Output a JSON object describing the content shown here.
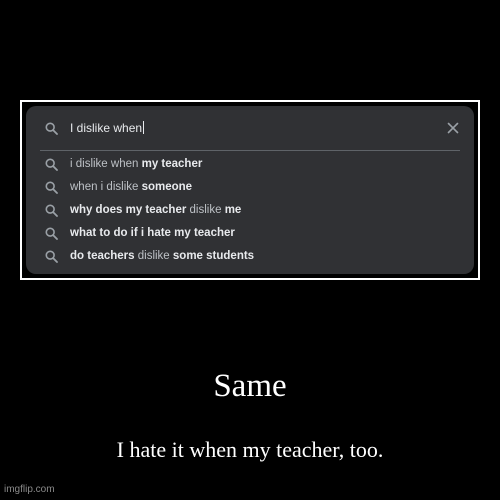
{
  "search": {
    "query": "I dislike when",
    "icon": "search-icon",
    "clear_icon": "close-icon"
  },
  "suggestions": [
    {
      "parts": [
        {
          "text": "i dislike when ",
          "bold": false
        },
        {
          "text": "my teacher",
          "bold": true
        }
      ]
    },
    {
      "parts": [
        {
          "text": "when i dislike ",
          "bold": false
        },
        {
          "text": "someone",
          "bold": true
        }
      ]
    },
    {
      "parts": [
        {
          "text": "why does my teacher ",
          "bold": true
        },
        {
          "text": "dislike ",
          "bold": false
        },
        {
          "text": "me",
          "bold": true
        }
      ]
    },
    {
      "parts": [
        {
          "text": "what to do if i hate my teacher",
          "bold": true
        }
      ]
    },
    {
      "parts": [
        {
          "text": "do teachers ",
          "bold": true
        },
        {
          "text": "dislike ",
          "bold": false
        },
        {
          "text": "some students",
          "bold": true
        }
      ]
    }
  ],
  "caption": {
    "title": "Same",
    "subtitle": "I hate it when my teacher, too."
  },
  "watermark": "imgflip.com",
  "colors": {
    "background": "#000000",
    "frame_border": "#ffffff",
    "panel": "#303134",
    "text_primary": "#e8eaed",
    "text_secondary": "#bdc1c6",
    "icon": "#9aa0a6"
  }
}
